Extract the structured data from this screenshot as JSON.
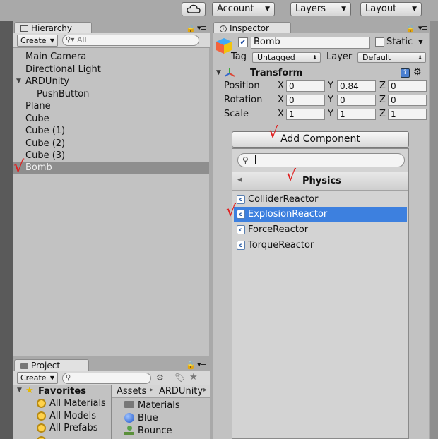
{
  "toolbar": {
    "account_label": "Account",
    "layers_label": "Layers",
    "layout_label": "Layout"
  },
  "hierarchy": {
    "tab_label": "Hierarchy",
    "create_label": "Create",
    "search_placeholder": "All",
    "items": [
      {
        "label": "Main Camera"
      },
      {
        "label": "Directional Light"
      },
      {
        "label": "ARDUnity"
      },
      {
        "label": "PushButton"
      },
      {
        "label": "Plane"
      },
      {
        "label": "Cube"
      },
      {
        "label": "Cube (1)"
      },
      {
        "label": "Cube (2)"
      },
      {
        "label": "Cube (3)"
      },
      {
        "label": "Bomb"
      }
    ]
  },
  "inspector": {
    "tab_label": "Inspector",
    "object_name": "Bomb",
    "static_label": "Static",
    "tag_label": "Tag",
    "tag_value": "Untagged",
    "layer_label": "Layer",
    "layer_value": "Default",
    "transform_title": "Transform",
    "rows": [
      {
        "label": "Position",
        "x": "0",
        "y": "0.84",
        "z": "0"
      },
      {
        "label": "Rotation",
        "x": "0",
        "y": "0",
        "z": "0"
      },
      {
        "label": "Scale",
        "x": "1",
        "y": "1",
        "z": "1"
      }
    ],
    "axis_x": "X",
    "axis_y": "Y",
    "axis_z": "Z",
    "add_component_label": "Add Component"
  },
  "component_popup": {
    "category": "Physics",
    "items": [
      {
        "label": "ColliderReactor"
      },
      {
        "label": "ExplosionReactor"
      },
      {
        "label": "ForceReactor"
      },
      {
        "label": "TorqueReactor"
      }
    ]
  },
  "project": {
    "tab_label": "Project",
    "create_label": "Create",
    "favorites_label": "Favorites",
    "favorites": [
      {
        "label": "All Materials"
      },
      {
        "label": "All Models"
      },
      {
        "label": "All Prefabs"
      }
    ],
    "breadcrumb_assets": "Assets",
    "breadcrumb_folder": "ARDUnity",
    "assets": [
      {
        "label": "Materials"
      },
      {
        "label": "Blue"
      },
      {
        "label": "Bounce"
      }
    ]
  },
  "colors": {
    "selection_blue": "#3d80df",
    "hierarchy_selection": "#8e8e8e",
    "annotation_red": "#e02020"
  }
}
